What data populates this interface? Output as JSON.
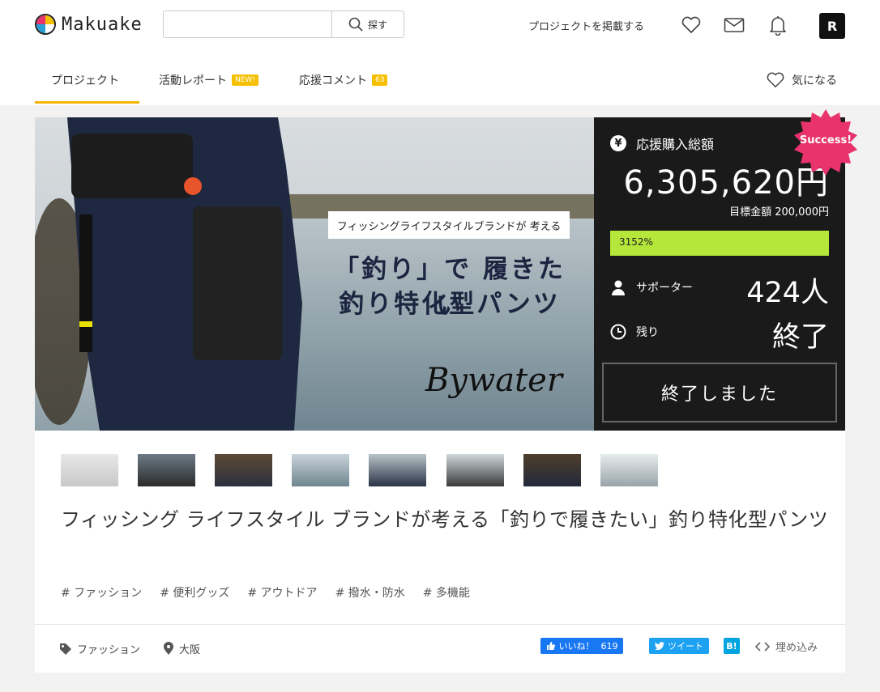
{
  "header": {
    "logo_text": "Makuake",
    "search": {
      "value": "",
      "placeholder": "",
      "button_label": "探す"
    },
    "post_project_label": "プロジェクトを掲載する",
    "avatar_letter": "R"
  },
  "tabs": [
    {
      "label": "プロジェクト",
      "badge": ""
    },
    {
      "label": "活動レポート",
      "badge": "NEW!"
    },
    {
      "label": "応援コメント",
      "badge": "63"
    }
  ],
  "favorite_label": "気になる",
  "hero": {
    "subtitle": "フィッシングライフスタイルブランドが 考える",
    "headline_line1": "「釣り」で 履きたい",
    "headline_line2": "釣り特化型パンツ",
    "brand_logo": "Bywater"
  },
  "funding": {
    "currency_symbol": "¥",
    "total_label": "応援購入総額",
    "total_amount": "6,305,620円",
    "goal_text": "目標金額 200,000円",
    "progress_percent": 3152,
    "progress_label": "3152%",
    "supporters_label": "サポーター",
    "supporters_value": "424人",
    "remaining_label": "残り",
    "remaining_value": "終了",
    "ended_button_label": "終了しました",
    "success_badge": "Success!"
  },
  "project": {
    "title": "フィッシング ライフスタイル ブランドが考える「釣りで履きたい」釣り特化型パンツ",
    "tags": [
      "# ファッション",
      "# 便利グッズ",
      "# アウトドア",
      "# 撥水・防水",
      "# 多機能"
    ],
    "category": "ファッション",
    "location": "大阪"
  },
  "share": {
    "like_label": "いいね！",
    "like_count": "619",
    "tweet_label": "ツイート",
    "hatena_label": "B!",
    "embed_label": "埋め込み"
  },
  "colors": {
    "accent_yellow": "#f4b400",
    "progress_green": "#b5e63a",
    "success_pink": "#e8336d",
    "facebook_blue": "#1877f2",
    "twitter_blue": "#1da1f2",
    "hatena_blue": "#00a4de"
  }
}
